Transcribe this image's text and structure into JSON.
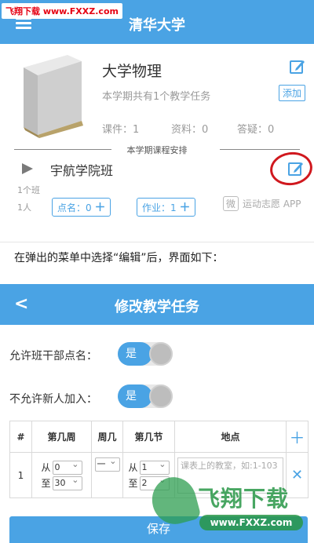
{
  "watermark_top": "飞翔下载 www.FXXZ.com",
  "screen1": {
    "title": "清华大学",
    "course": {
      "name": "大学物理",
      "task_count_text": "本学期共有1个教学任务",
      "add_label": "添加",
      "stats": [
        "课件：1",
        "资料：0",
        "答疑：0"
      ]
    },
    "section_title": "本学期课程安排",
    "class_item": {
      "name": "宇航学院班",
      "classes": "1个班",
      "people": "1人",
      "rollcall_label": "点名：0",
      "homework_label": "作业：1"
    },
    "wechat_mark": "运动志愿 APP"
  },
  "caption": "在弹出的菜单中选择“编辑”后，界面如下：",
  "screen2": {
    "title": "修改教学任务",
    "allow_cadre_rollcall": {
      "label": "允许班干部点名：",
      "value": "是"
    },
    "disallow_new_join": {
      "label": "不允许新人加入：",
      "value": "是"
    },
    "table": {
      "headers": [
        "#",
        "第几周",
        "周几",
        "第几节",
        "地点"
      ],
      "row": {
        "index": "1",
        "week_from_prefix": "从",
        "week_from": "0",
        "week_to_prefix": "至",
        "week_to": "30",
        "weekday": "一",
        "section_from_prefix": "从",
        "section_from": "1",
        "section_to_prefix": "至",
        "section_to": "2",
        "location_placeholder": "课表上的教室，如:1-103"
      }
    },
    "save_label": "保存"
  },
  "watermark_bottom": {
    "text": "飞翔下载",
    "url": "www.FXXZ.com"
  },
  "colors": {
    "primary": "#4aa3e4",
    "highlight_circle": "#d0181e",
    "watermark_green": "#2e9e50"
  }
}
